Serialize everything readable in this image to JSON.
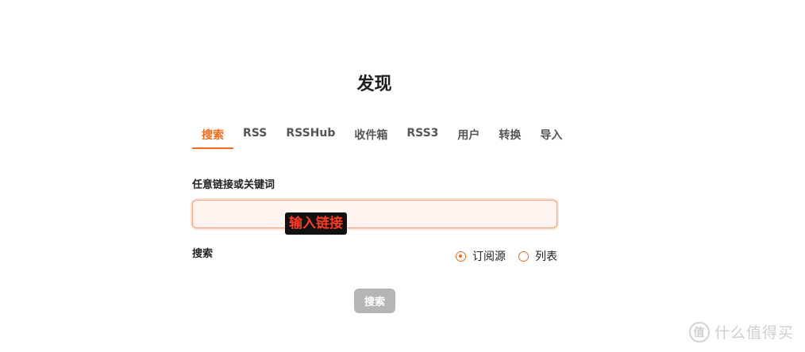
{
  "page_title": "发现",
  "tabs": [
    {
      "label": "搜索",
      "active": true
    },
    {
      "label": "RSS",
      "active": false
    },
    {
      "label": "RSSHub",
      "active": false
    },
    {
      "label": "收件箱",
      "active": false
    },
    {
      "label": "RSS3",
      "active": false
    },
    {
      "label": "用户",
      "active": false
    },
    {
      "label": "转换",
      "active": false
    },
    {
      "label": "导入",
      "active": false
    }
  ],
  "form": {
    "field_label": "任意链接或关键词",
    "input_value": "",
    "overlay_text": "输入链接",
    "search_label": "搜索",
    "radio_options": [
      {
        "label": "订阅源",
        "checked": true
      },
      {
        "label": "列表",
        "checked": false
      }
    ],
    "submit_label": "搜索"
  },
  "watermark": {
    "badge": "值",
    "text": "什么值得买"
  },
  "colors": {
    "accent": "#f26a1b",
    "input_bg": "#fff4ef",
    "button_disabled": "#b5b5b5"
  }
}
